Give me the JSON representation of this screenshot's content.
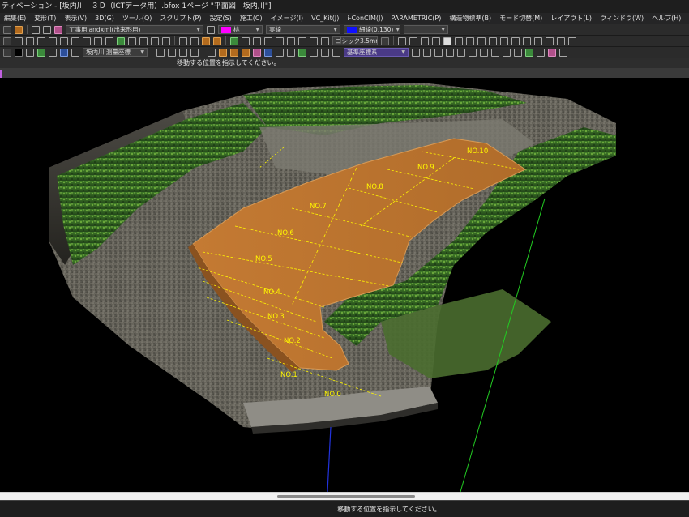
{
  "app": {
    "title": "ティベーション - [坂内川　３Ｄ（ICTデータ用）.bfox 1ページ \"平面図　坂内川\"]"
  },
  "menu": [
    "編集(E)",
    "変形(T)",
    "表示(V)",
    "3D(G)",
    "ツール(Q)",
    "スクリプト(P)",
    "設定(S)",
    "施工(C)",
    "イメージ(I)",
    "VC_Kit(J)",
    "i-ConCIM(J)",
    "PARAMETRIC(P)",
    "構造物標準(B)",
    "モード切替(M)",
    "レイアウト(L)",
    "ウィンドウ(W)",
    "ヘルプ(H)"
  ],
  "toolbar1": {
    "layer_value": "工事用landxml(出来形用)",
    "color_label": "桃",
    "color_hex": "#ff00ff",
    "linetype_label": "実線",
    "linewidth_label": "細線(0.130)",
    "linewidth_color": "#1010ff"
  },
  "toolbar2": {
    "font_value": "ゴシック3.5mm"
  },
  "toolbar3": {
    "coord_value": "坂内川 測量座標",
    "base_coord_value": "基準座標系"
  },
  "prompt": "移動する位置を指示してください。",
  "status": "移動する位置を指示してください。",
  "stations": [
    "NO.0",
    "NO.1",
    "NO.2",
    "NO.3",
    "NO.4",
    "NO.5",
    "NO.6",
    "NO.7",
    "NO.8",
    "NO.9",
    "NO.10"
  ],
  "colors": {
    "surface_fill": "#b8722e",
    "station_label": "#fff600",
    "axis_green": "#22cc22",
    "axis_blue": "#2233dd"
  }
}
